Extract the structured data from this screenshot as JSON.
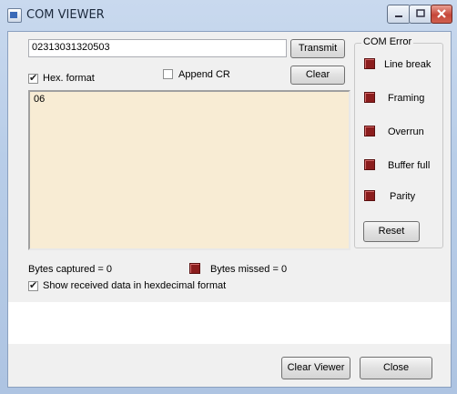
{
  "window": {
    "title": "COM VIEWER"
  },
  "input": {
    "value": "02313031320503"
  },
  "buttons": {
    "transmit": "Transmit",
    "clear": "Clear",
    "reset": "Reset",
    "clear_viewer": "Clear Viewer",
    "close": "Close"
  },
  "options": {
    "hex_format": {
      "label": "Hex. format",
      "checked": true
    },
    "append_cr": {
      "label": "Append CR",
      "checked": false
    },
    "show_hex": {
      "label": "Show received data in hexdecimal format",
      "checked": true
    }
  },
  "receive": {
    "text": "06"
  },
  "com_error": {
    "title": "COM Error",
    "items": [
      {
        "label": "Line break"
      },
      {
        "label": "Framing"
      },
      {
        "label": "Overrun"
      },
      {
        "label": "Buffer full"
      },
      {
        "label": "Parity"
      }
    ]
  },
  "status": {
    "bytes_captured": "Bytes captured  = 0",
    "bytes_missed": "Bytes missed = 0"
  },
  "colors": {
    "led": "#8b1d1d",
    "receive_bg": "#f8ecd4"
  }
}
